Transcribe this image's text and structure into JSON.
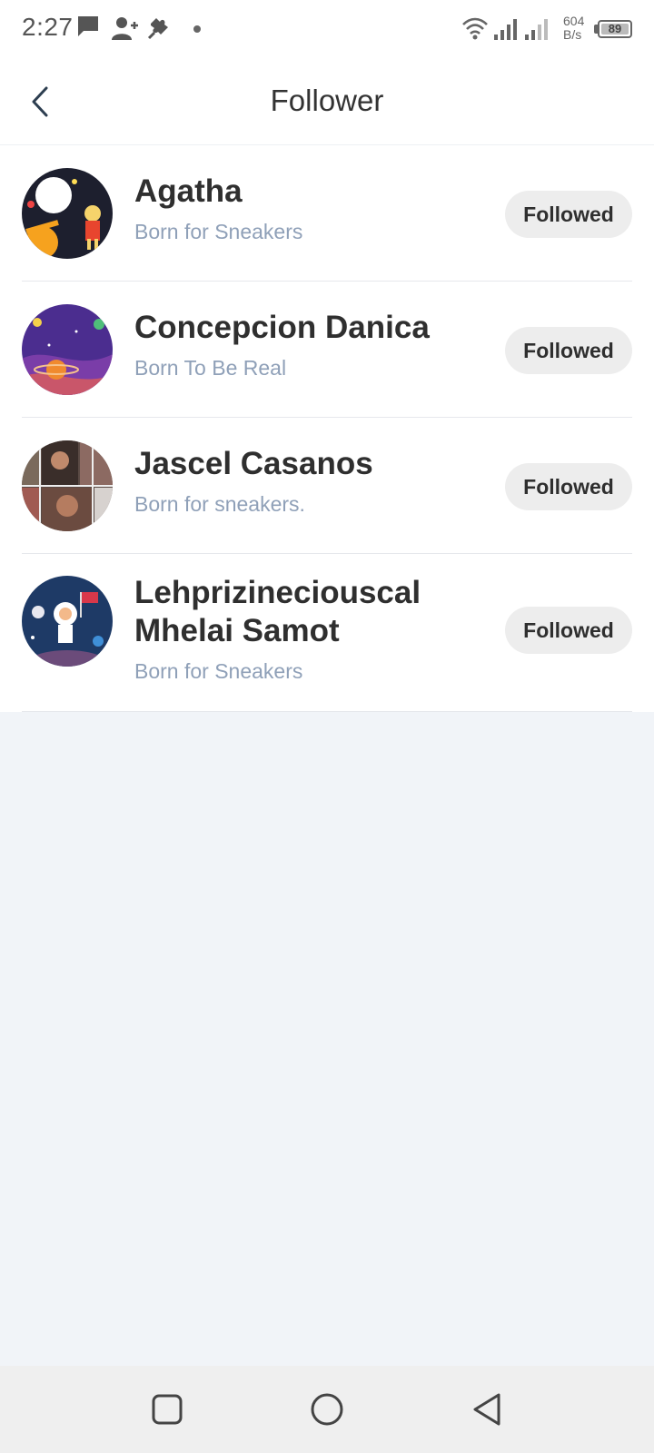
{
  "status_bar": {
    "time": "2:27",
    "icons": [
      "message-icon",
      "add-contact-icon",
      "puzzle-icon",
      "notification-dot-icon",
      "wifi-icon",
      "signal-icon",
      "signal-weak-icon"
    ],
    "net_speed_value": "604",
    "net_speed_unit": "B/s",
    "battery": "89"
  },
  "header": {
    "title": "Follower",
    "back_icon": "chevron-left-icon"
  },
  "followers": [
    {
      "name": "Agatha",
      "bio": "Born for Sneakers",
      "button": "Followed"
    },
    {
      "name": "Concepcion Danica",
      "bio": "Born To Be Real",
      "button": "Followed"
    },
    {
      "name": "Jascel Casanos",
      "bio": "Born for sneakers.",
      "button": "Followed"
    },
    {
      "name": "Lehprizineciouscal Mhelai Samot",
      "bio": "Born for Sneakers",
      "button": "Followed"
    }
  ],
  "nav_bar": {
    "icons": [
      "recent-apps-icon",
      "home-icon",
      "back-icon"
    ]
  },
  "colors": {
    "background": "#f1f4f8",
    "name_text": "#2f2f2f",
    "bio_text": "#8fa0b8",
    "button_bg": "#ededed"
  }
}
